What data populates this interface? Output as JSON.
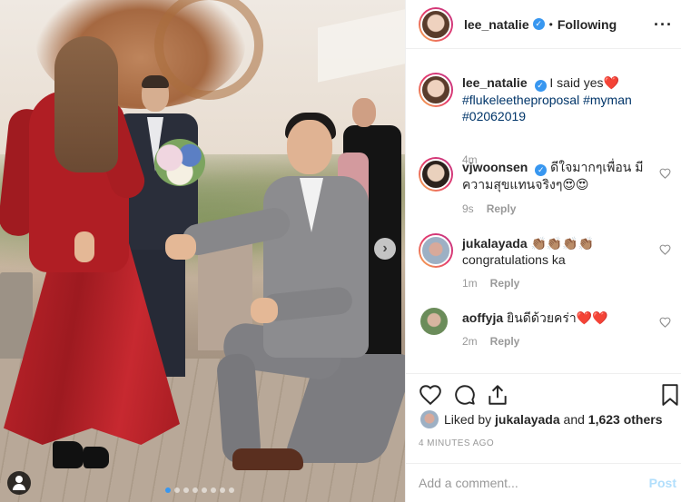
{
  "post": {
    "username": "lee_natalie",
    "follow_separator": "•",
    "follow_status": "Following",
    "more_icon": "more-horizontal-icon"
  },
  "photo": {
    "carousel_total": 8,
    "carousel_active": 1,
    "next_icon": "chevron-right-icon",
    "tag_icon": "user-tag-icon"
  },
  "caption": {
    "username": "lee_natalie",
    "text": "I said yes",
    "emoji": "❤️",
    "tags": "#flukeleetheproposal #myman #02062019",
    "time": "4m"
  },
  "comments": [
    {
      "username": "vjwoonsen",
      "text": "ดีใจมากๆเพื่อน มีความสุขแทนจริงๆ😍😍",
      "time": "9s",
      "reply_label": "Reply"
    },
    {
      "username": "jukalayada",
      "text": "👏🏽👏🏽👏🏽👏🏽 congratulations ka",
      "time": "1m",
      "reply_label": "Reply"
    },
    {
      "username": "aoffyja",
      "text": "ยินดีด้วยคร่า❤️❤️",
      "time": "2m",
      "reply_label": "Reply"
    }
  ],
  "actions": {
    "like_icon": "heart-outline-icon",
    "comment_icon": "comment-icon",
    "share_icon": "share-icon",
    "save_icon": "bookmark-icon"
  },
  "likes": {
    "prefix": "Liked by",
    "user": "jukalayada",
    "and": "and",
    "others": "1,623 others"
  },
  "timestamp": "4 MINUTES AGO",
  "add_comment": {
    "placeholder": "Add a comment...",
    "post_label": "Post"
  },
  "colors": {
    "accent": "#3897f0",
    "link": "#003569",
    "muted": "#999999",
    "post_disabled": "#b2dffc"
  }
}
